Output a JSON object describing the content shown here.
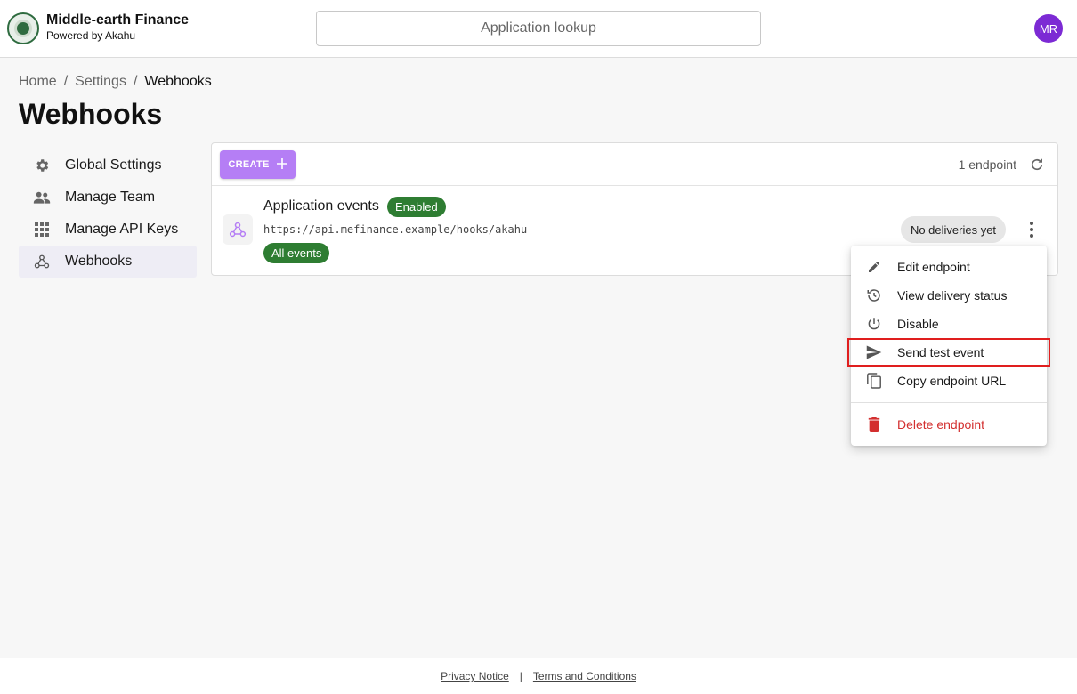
{
  "header": {
    "brand_title": "Middle-earth Finance",
    "brand_subtitle": "Powered by Akahu",
    "search_placeholder": "Application lookup",
    "avatar_initials": "MR"
  },
  "breadcrumb": {
    "items": [
      "Home",
      "Settings",
      "Webhooks"
    ],
    "separator": "/"
  },
  "page_title": "Webhooks",
  "sidebar": {
    "items": [
      {
        "label": "Global Settings",
        "icon": "gear-icon"
      },
      {
        "label": "Manage Team",
        "icon": "people-icon"
      },
      {
        "label": "Manage API Keys",
        "icon": "grid-icon"
      },
      {
        "label": "Webhooks",
        "icon": "webhook-icon",
        "active": true
      }
    ]
  },
  "toolbar": {
    "create_label": "CREATE",
    "endpoint_count": "1 endpoint"
  },
  "endpoint": {
    "name": "Application events",
    "status": "Enabled",
    "url": "https://api.mefinance.example/hooks/akahu",
    "events_chip": "All events",
    "delivery_status": "No deliveries yet"
  },
  "menu": {
    "items": [
      {
        "label": "Edit endpoint",
        "icon": "pencil-icon"
      },
      {
        "label": "View delivery status",
        "icon": "history-icon"
      },
      {
        "label": "Disable",
        "icon": "power-icon"
      },
      {
        "label": "Send test event",
        "icon": "send-icon",
        "highlighted": true
      },
      {
        "label": "Copy endpoint URL",
        "icon": "copy-icon"
      },
      {
        "label": "Delete endpoint",
        "icon": "trash-icon",
        "danger": true
      }
    ]
  },
  "footer": {
    "privacy": "Privacy Notice",
    "separator": "|",
    "terms": "Terms and Conditions"
  },
  "colors": {
    "accent": "#b57ef5",
    "avatar": "#7c2ad4",
    "success": "#2e7d32",
    "danger": "#d32f2f",
    "highlight_outline": "#e01e1e"
  }
}
